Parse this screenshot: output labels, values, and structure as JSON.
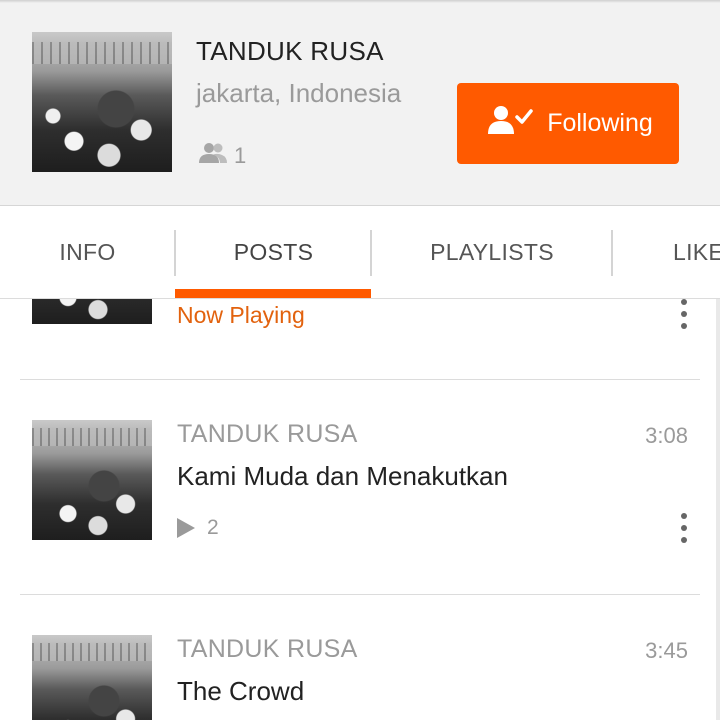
{
  "header": {
    "artist_name": "TANDUK RUSA",
    "location": "jakarta, Indonesia",
    "followers_count": "1",
    "follow_button_label": "Following"
  },
  "tabs": [
    {
      "label": "INFO"
    },
    {
      "label": "POSTS",
      "active": true
    },
    {
      "label": "PLAYLISTS"
    },
    {
      "label": "LIKE"
    }
  ],
  "colors": {
    "accent": "#ff5a00",
    "now_playing": "#e2620e"
  },
  "tracks": [
    {
      "status": "Now Playing"
    },
    {
      "artist": "TANDUK RUSA",
      "title": "Kami Muda dan Menakutkan",
      "duration": "3:08",
      "plays": "2"
    },
    {
      "artist": "TANDUK RUSA",
      "title": "The Crowd",
      "duration": "3:45"
    }
  ]
}
